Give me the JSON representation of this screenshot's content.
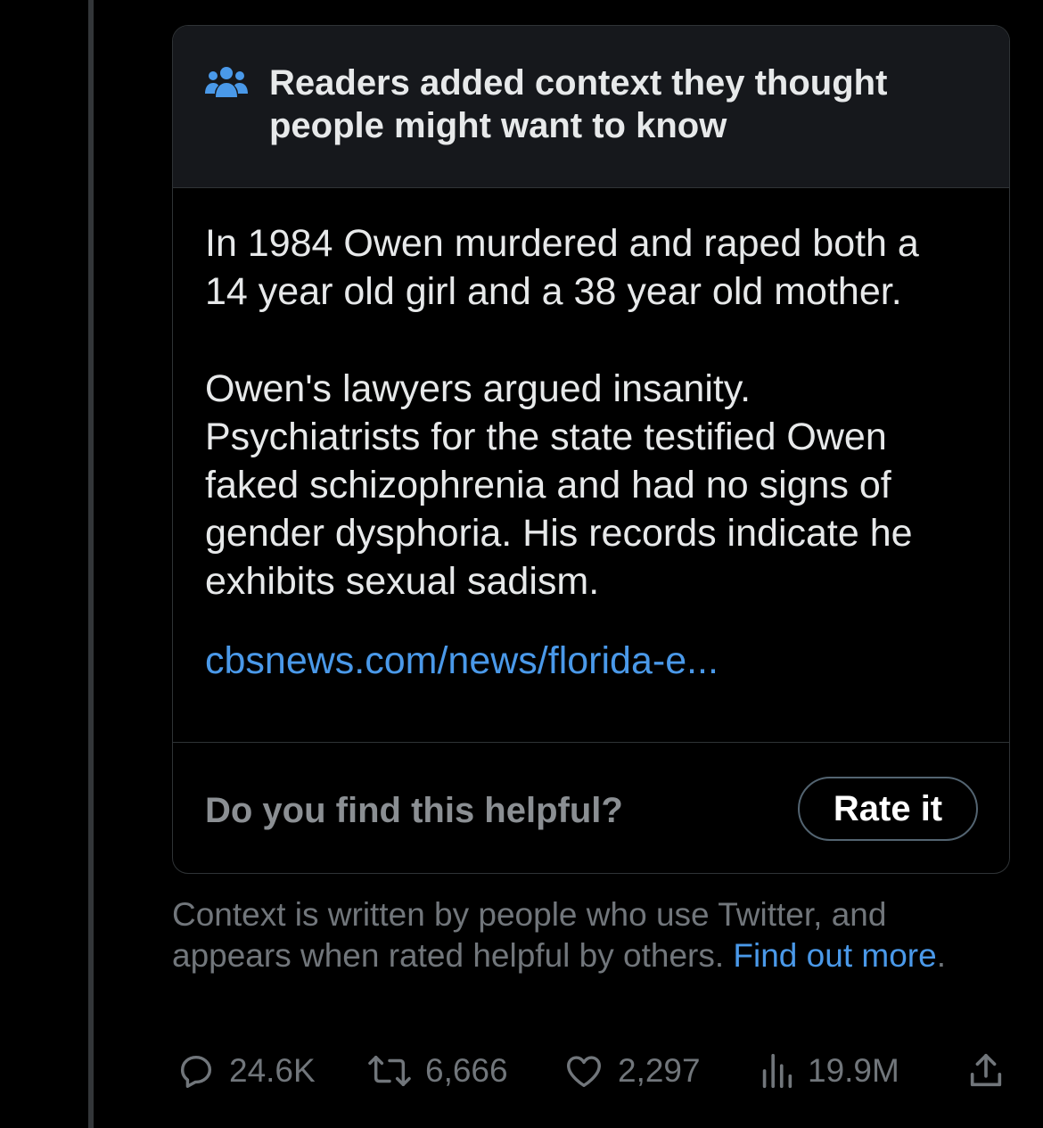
{
  "note": {
    "header_title": "Readers added context they thought people might want to know",
    "paragraph_1": "In 1984 Owen murdered and raped both a 14 year old girl and a 38 year old mother.",
    "paragraph_2": "Owen's lawyers argued insanity. Psychiatrists for the state testified Owen faked schizophrenia and had no signs of gender dysphoria. His records indicate he exhibits sexual sadism.",
    "source_link": "cbsnews.com/news/florida-e...",
    "helpful_question": "Do you find this helpful?",
    "rate_button": "Rate it"
  },
  "context_info": {
    "text": "Context is written by people who use Twitter, and appears when rated helpful by others.",
    "link": "Find out more",
    "period": "."
  },
  "actions": {
    "replies": "24.6K",
    "retweets": "6,666",
    "likes": "2,297",
    "views": "19.9M"
  },
  "colors": {
    "background": "#000000",
    "header_bg": "#16181c",
    "accent": "#4a99e9",
    "muted": "#71767b"
  }
}
